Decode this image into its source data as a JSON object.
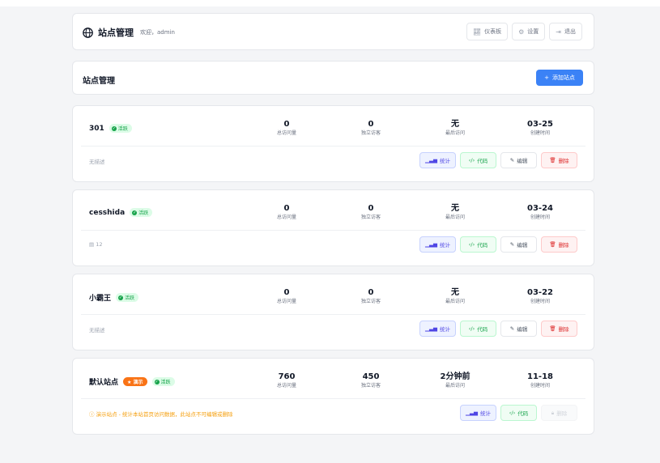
{
  "header": {
    "title": "站点管理",
    "welcome": "欢迎，admin",
    "buttons": [
      {
        "icon": "chart-line-icon",
        "label": "仪表板"
      },
      {
        "icon": "gear-icon",
        "label": "设置"
      },
      {
        "icon": "logout-icon",
        "label": "退出"
      }
    ]
  },
  "section": {
    "title": "站点管理",
    "add_label": "添加站点"
  },
  "stat_labels": {
    "total": "总访问量",
    "unique": "独立访客",
    "last": "最后访问",
    "created": "创建时间"
  },
  "action_labels": {
    "stats": "统计",
    "code": "代码",
    "edit": "编辑",
    "delete": "删除"
  },
  "sites": [
    {
      "name": "301",
      "status": "活跃",
      "total": "0",
      "unique": "0",
      "last": "无",
      "created": "03-25",
      "desc": "无描述"
    },
    {
      "name": "cesshida",
      "status": "活跃",
      "total": "0",
      "unique": "0",
      "last": "无",
      "created": "03-24",
      "desc": "12"
    },
    {
      "name": "小霸王",
      "status": "活跃",
      "total": "0",
      "unique": "0",
      "last": "无",
      "created": "03-22",
      "desc": "无描述"
    },
    {
      "name": "默认站点",
      "demo_badge": "演示",
      "status": "活跃",
      "total": "760",
      "unique": "450",
      "last": "2分钟前",
      "created": "11-18",
      "desc": "演示站点 - 统计本站首页访问数据，此站点不可编辑或删除"
    }
  ],
  "colors": {
    "primary": "#3b82f6",
    "active": "#16a34a",
    "demo": "#f97316",
    "danger": "#dc2626"
  }
}
